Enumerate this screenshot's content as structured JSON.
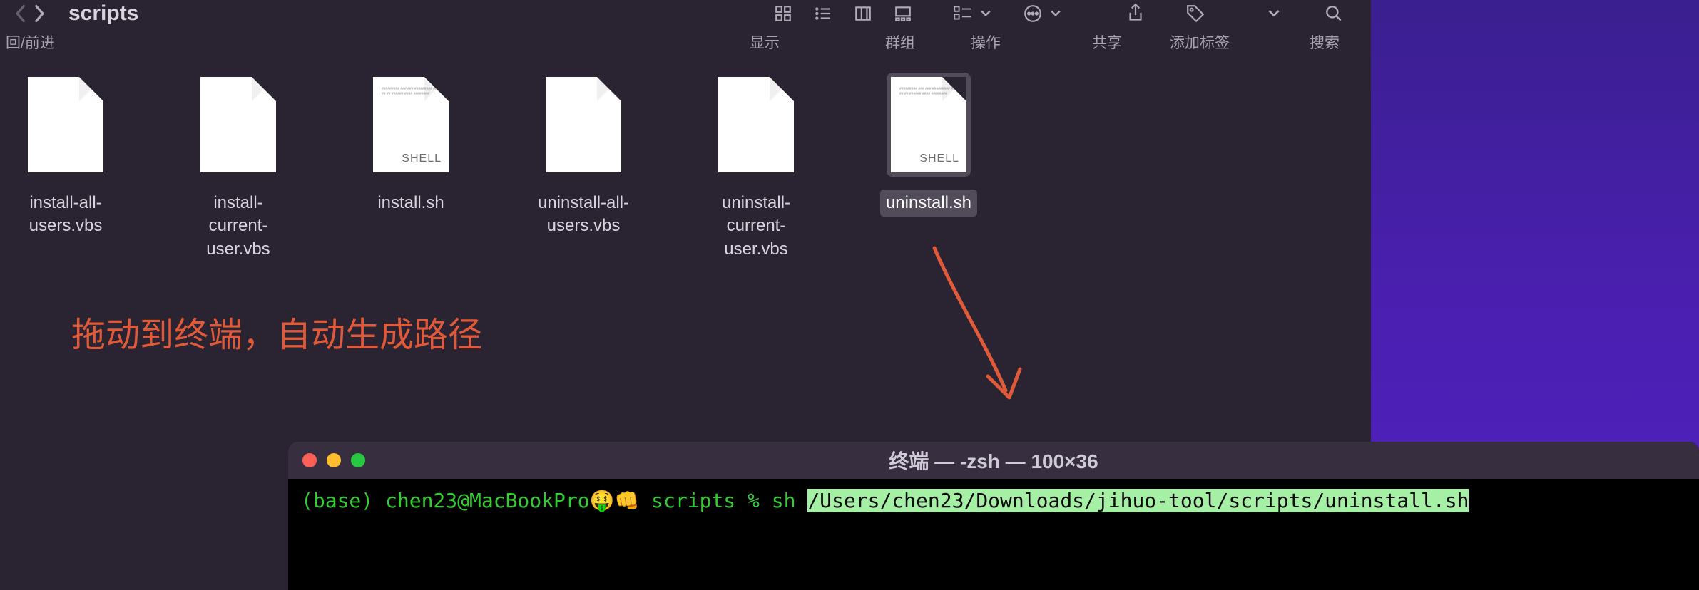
{
  "finder": {
    "folder_title": "scripts",
    "sublabels": {
      "nav": "回/前进",
      "view": "显示",
      "group": "群组",
      "action": "操作",
      "share": "共享",
      "tags": "添加标签",
      "search": "搜索"
    },
    "files": [
      {
        "name": "install-all-users.vbs",
        "type": "plain"
      },
      {
        "name": "install-current-user.vbs",
        "type": "plain"
      },
      {
        "name": "install.sh",
        "type": "shell"
      },
      {
        "name": "uninstall-all-users.vbs",
        "type": "plain"
      },
      {
        "name": "uninstall-current-user.vbs",
        "type": "plain"
      },
      {
        "name": "uninstall.sh",
        "type": "shell",
        "selected": true
      }
    ],
    "shell_tag": "SHELL"
  },
  "annotation": {
    "text": "拖动到终端，自动生成路径"
  },
  "terminal": {
    "title": "终端 — -zsh — 100×36",
    "prompt": "(base) chen23@MacBookPro🤑👊 scripts % sh ",
    "path": "/Users/chen23/Downloads/jihuo-tool/scripts/uninstall.sh"
  }
}
